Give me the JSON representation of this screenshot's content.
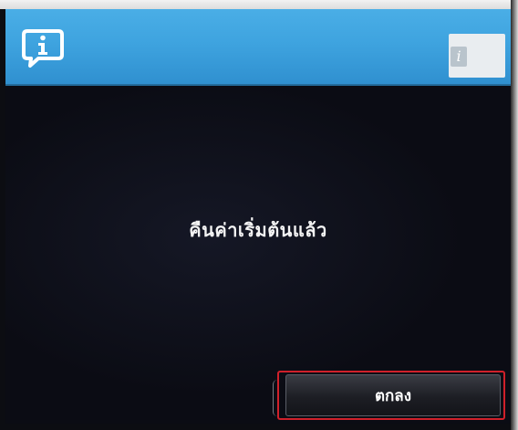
{
  "dialog": {
    "header_icon": "info-speech-bubble-icon",
    "header_badge_icon": "info-badge-icon",
    "message": "คืนค่าเริ่มต้นแล้ว",
    "ok_label": "ตกลง"
  },
  "colors": {
    "header": "#3ea3df",
    "body": "#0b0c14",
    "ok_highlight": "#d0202a"
  }
}
